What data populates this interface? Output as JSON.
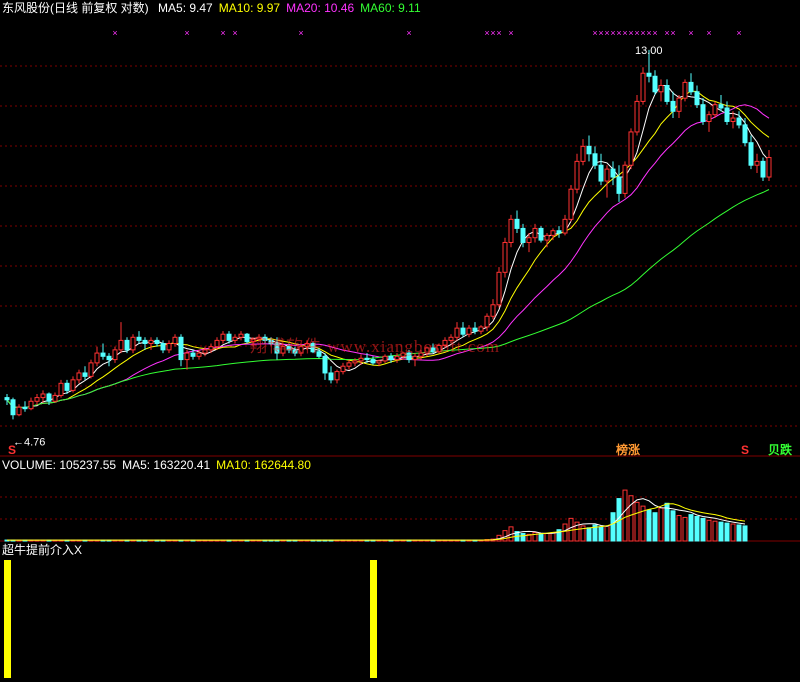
{
  "header": {
    "stock_label": "东风股份(日线 前复权 对数)",
    "ma_labels": [
      {
        "text": "MA5: 9.47",
        "color": "#ffffff"
      },
      {
        "text": "MA10: 9.97",
        "color": "#ffff00"
      },
      {
        "text": "MA20: 10.46",
        "color": "#ff33ff"
      },
      {
        "text": "MA60: 9.11",
        "color": "#33ff33"
      }
    ]
  },
  "volume_header": {
    "labels": [
      {
        "text": "VOLUME: 105237.55",
        "color": "#ffffff"
      },
      {
        "text": "MA5: 163220.41",
        "color": "#ffffff"
      },
      {
        "text": "MA10: 162644.80",
        "color": "#ffff00"
      }
    ]
  },
  "indicator_header": {
    "label": "超牛提前介入X",
    "color": "#ffffff"
  },
  "watermark": "翔博软件 www.xiangbosoft.com",
  "colors": {
    "up": "#ff3232",
    "down": "#54ffff",
    "grid": "#800000",
    "ma5": "#ffffff",
    "ma10": "#ffff00",
    "ma20": "#ff33ff",
    "ma60": "#33ff33",
    "signal_bar": "#ffff00",
    "cross_marker": "#ff33ff",
    "s_marker": "#ff3232"
  },
  "chart_data": {
    "type": "candlestick",
    "price_scale": "log",
    "ylim": [
      4.5,
      13.5
    ],
    "annotations": {
      "high": {
        "label": "13.00",
        "value": 13.0
      },
      "low": {
        "label": "←4.76",
        "value": 4.76
      }
    },
    "event_labels": [
      {
        "text": "榜涨",
        "color": "#ff9933"
      },
      {
        "text": "S",
        "color": "#ff3232"
      },
      {
        "text": "S",
        "color": "#ff3232"
      },
      {
        "text": "贝跌",
        "color": "#33ff33"
      }
    ],
    "candles_ohlc": [
      [
        5.05,
        5.1,
        4.95,
        5.02
      ],
      [
        5.02,
        5.05,
        4.76,
        4.82
      ],
      [
        4.82,
        4.96,
        4.8,
        4.92
      ],
      [
        4.92,
        5.0,
        4.86,
        4.9
      ],
      [
        4.9,
        5.05,
        4.88,
        5.0
      ],
      [
        5.0,
        5.1,
        4.95,
        5.05
      ],
      [
        5.05,
        5.15,
        4.98,
        5.1
      ],
      [
        5.1,
        5.12,
        4.95,
        5.0
      ],
      [
        5.0,
        5.12,
        4.98,
        5.08
      ],
      [
        5.08,
        5.3,
        5.05,
        5.25
      ],
      [
        5.25,
        5.3,
        5.1,
        5.15
      ],
      [
        5.15,
        5.35,
        5.12,
        5.3
      ],
      [
        5.3,
        5.45,
        5.25,
        5.4
      ],
      [
        5.4,
        5.5,
        5.3,
        5.35
      ],
      [
        5.35,
        5.6,
        5.32,
        5.55
      ],
      [
        5.55,
        5.8,
        5.5,
        5.7
      ],
      [
        5.7,
        5.85,
        5.6,
        5.65
      ],
      [
        5.65,
        5.7,
        5.5,
        5.6
      ],
      [
        5.6,
        5.8,
        5.55,
        5.75
      ],
      [
        5.75,
        6.2,
        5.7,
        5.9
      ],
      [
        5.9,
        5.95,
        5.7,
        5.75
      ],
      [
        5.75,
        6.0,
        5.7,
        5.95
      ],
      [
        5.95,
        6.05,
        5.85,
        5.9
      ],
      [
        5.9,
        5.95,
        5.75,
        5.85
      ],
      [
        5.85,
        5.95,
        5.75,
        5.9
      ],
      [
        5.9,
        5.95,
        5.8,
        5.85
      ],
      [
        5.85,
        5.9,
        5.7,
        5.75
      ],
      [
        5.75,
        5.9,
        5.7,
        5.85
      ],
      [
        5.85,
        6.0,
        5.8,
        5.95
      ],
      [
        5.95,
        6.0,
        5.5,
        5.6
      ],
      [
        5.6,
        5.75,
        5.45,
        5.7
      ],
      [
        5.7,
        5.75,
        5.6,
        5.65
      ],
      [
        5.65,
        5.75,
        5.6,
        5.7
      ],
      [
        5.7,
        5.8,
        5.65,
        5.75
      ],
      [
        5.75,
        5.85,
        5.7,
        5.8
      ],
      [
        5.8,
        5.95,
        5.75,
        5.9
      ],
      [
        5.9,
        6.05,
        5.85,
        6.0
      ],
      [
        6.0,
        6.05,
        5.85,
        5.9
      ],
      [
        5.9,
        6.0,
        5.85,
        5.95
      ],
      [
        5.95,
        6.05,
        5.9,
        6.0
      ],
      [
        6.0,
        6.02,
        5.85,
        5.88
      ],
      [
        5.88,
        5.95,
        5.8,
        5.92
      ],
      [
        5.92,
        6.0,
        5.88,
        5.95
      ],
      [
        5.95,
        6.0,
        5.85,
        5.9
      ],
      [
        5.9,
        5.95,
        5.82,
        5.85
      ],
      [
        5.85,
        5.95,
        5.6,
        5.7
      ],
      [
        5.7,
        5.85,
        5.65,
        5.8
      ],
      [
        5.8,
        5.85,
        5.7,
        5.75
      ],
      [
        5.75,
        5.8,
        5.65,
        5.7
      ],
      [
        5.7,
        5.85,
        5.65,
        5.8
      ],
      [
        5.8,
        5.9,
        5.75,
        5.85
      ],
      [
        5.85,
        5.88,
        5.7,
        5.72
      ],
      [
        5.72,
        5.78,
        5.62,
        5.65
      ],
      [
        5.65,
        5.7,
        5.3,
        5.4
      ],
      [
        5.4,
        5.5,
        5.25,
        5.3
      ],
      [
        5.3,
        5.45,
        5.25,
        5.42
      ],
      [
        5.42,
        5.55,
        5.38,
        5.5
      ],
      [
        5.5,
        5.6,
        5.45,
        5.55
      ],
      [
        5.55,
        5.62,
        5.5,
        5.58
      ],
      [
        5.58,
        5.68,
        5.52,
        5.62
      ],
      [
        5.62,
        5.7,
        5.55,
        5.6
      ],
      [
        5.6,
        5.65,
        5.52,
        5.55
      ],
      [
        5.55,
        5.6,
        5.5,
        5.58
      ],
      [
        5.58,
        5.68,
        5.55,
        5.65
      ],
      [
        5.65,
        5.7,
        5.55,
        5.6
      ],
      [
        5.6,
        5.7,
        5.55,
        5.65
      ],
      [
        5.65,
        5.72,
        5.6,
        5.7
      ],
      [
        5.7,
        5.75,
        5.55,
        5.6
      ],
      [
        5.6,
        5.7,
        5.5,
        5.65
      ],
      [
        5.65,
        5.75,
        5.6,
        5.7
      ],
      [
        5.7,
        5.8,
        5.65,
        5.78
      ],
      [
        5.78,
        5.85,
        5.7,
        5.72
      ],
      [
        5.72,
        5.85,
        5.7,
        5.82
      ],
      [
        5.82,
        5.95,
        5.78,
        5.9
      ],
      [
        5.9,
        6.0,
        5.85,
        5.95
      ],
      [
        5.95,
        6.2,
        5.9,
        6.1
      ],
      [
        6.1,
        6.2,
        5.95,
        6.0
      ],
      [
        6.0,
        6.15,
        5.95,
        6.1
      ],
      [
        6.1,
        6.2,
        6.0,
        6.05
      ],
      [
        6.05,
        6.15,
        6.0,
        6.12
      ],
      [
        6.12,
        6.35,
        6.05,
        6.3
      ],
      [
        6.3,
        6.6,
        6.25,
        6.5
      ],
      [
        6.5,
        7.2,
        6.45,
        7.1
      ],
      [
        7.1,
        7.8,
        7.0,
        7.7
      ],
      [
        7.7,
        8.3,
        7.6,
        8.2
      ],
      [
        8.2,
        8.4,
        7.9,
        8.0
      ],
      [
        8.0,
        8.1,
        7.6,
        7.7
      ],
      [
        7.7,
        7.9,
        7.5,
        7.8
      ],
      [
        7.8,
        8.1,
        7.7,
        8.0
      ],
      [
        8.0,
        8.05,
        7.7,
        7.75
      ],
      [
        7.75,
        7.9,
        7.6,
        7.85
      ],
      [
        7.85,
        8.0,
        7.75,
        7.95
      ],
      [
        7.95,
        8.05,
        7.8,
        7.9
      ],
      [
        7.9,
        8.3,
        7.85,
        8.2
      ],
      [
        8.2,
        9.0,
        8.15,
        8.9
      ],
      [
        8.9,
        9.8,
        8.8,
        9.6
      ],
      [
        9.6,
        10.2,
        9.5,
        10.0
      ],
      [
        10.0,
        10.3,
        9.6,
        9.8
      ],
      [
        9.8,
        10.0,
        9.4,
        9.5
      ],
      [
        9.5,
        9.8,
        9.0,
        9.1
      ],
      [
        9.1,
        9.5,
        8.7,
        9.4
      ],
      [
        9.4,
        9.6,
        9.0,
        9.2
      ],
      [
        9.2,
        9.5,
        8.6,
        8.8
      ],
      [
        8.8,
        9.6,
        8.7,
        9.5
      ],
      [
        9.5,
        10.5,
        9.4,
        10.4
      ],
      [
        10.4,
        11.5,
        10.3,
        11.3
      ],
      [
        11.3,
        12.4,
        11.2,
        12.2
      ],
      [
        12.2,
        13.0,
        11.9,
        12.1
      ],
      [
        12.1,
        12.3,
        11.5,
        11.6
      ],
      [
        11.6,
        12.0,
        11.3,
        11.8
      ],
      [
        11.8,
        12.0,
        11.2,
        11.3
      ],
      [
        11.3,
        11.6,
        10.8,
        11.0
      ],
      [
        11.0,
        11.5,
        10.8,
        11.4
      ],
      [
        11.4,
        12.0,
        11.3,
        11.9
      ],
      [
        11.9,
        12.2,
        11.5,
        11.6
      ],
      [
        11.6,
        11.8,
        11.1,
        11.2
      ],
      [
        11.2,
        11.4,
        10.6,
        10.7
      ],
      [
        10.7,
        11.0,
        10.4,
        10.9
      ],
      [
        10.9,
        11.3,
        10.8,
        11.2
      ],
      [
        11.2,
        11.5,
        11.0,
        11.1
      ],
      [
        11.1,
        11.3,
        10.6,
        10.7
      ],
      [
        10.7,
        11.0,
        10.5,
        10.8
      ],
      [
        10.8,
        11.0,
        10.5,
        10.6
      ],
      [
        10.6,
        10.8,
        10.0,
        10.1
      ],
      [
        10.1,
        10.3,
        9.4,
        9.5
      ],
      [
        9.5,
        9.8,
        9.3,
        9.6
      ],
      [
        9.6,
        9.7,
        9.1,
        9.2
      ],
      [
        9.2,
        9.9,
        9.1,
        9.7
      ]
    ],
    "volume": [
      2,
      2,
      2,
      2,
      2,
      2,
      2,
      2,
      2,
      2,
      2,
      2,
      2,
      2,
      2,
      2,
      2,
      2,
      2,
      2,
      2,
      2,
      2,
      2,
      2,
      2,
      2,
      2,
      2,
      2,
      2,
      2,
      2,
      2,
      2,
      2,
      2,
      2,
      2,
      2,
      2,
      2,
      2,
      2,
      2,
      2,
      2,
      2,
      2,
      2,
      2,
      2,
      2,
      2,
      2,
      2,
      2,
      2,
      2,
      2,
      2,
      2,
      2,
      2,
      2,
      2,
      2,
      2,
      2,
      2,
      2,
      2,
      2,
      2,
      2,
      2,
      2,
      2,
      2,
      2,
      3,
      4,
      12,
      22,
      30,
      20,
      16,
      14,
      18,
      16,
      16,
      18,
      24,
      36,
      48,
      40,
      32,
      28,
      34,
      30,
      32,
      60,
      90,
      108,
      96,
      82,
      74,
      66,
      60,
      70,
      80,
      64,
      54,
      50,
      56,
      52,
      48,
      44,
      42,
      40,
      38,
      36,
      34,
      32
    ],
    "volume_ylim": [
      0,
      140000
    ],
    "volume_unit_scale": 1000,
    "indicator_bars": [
      0,
      61
    ]
  }
}
